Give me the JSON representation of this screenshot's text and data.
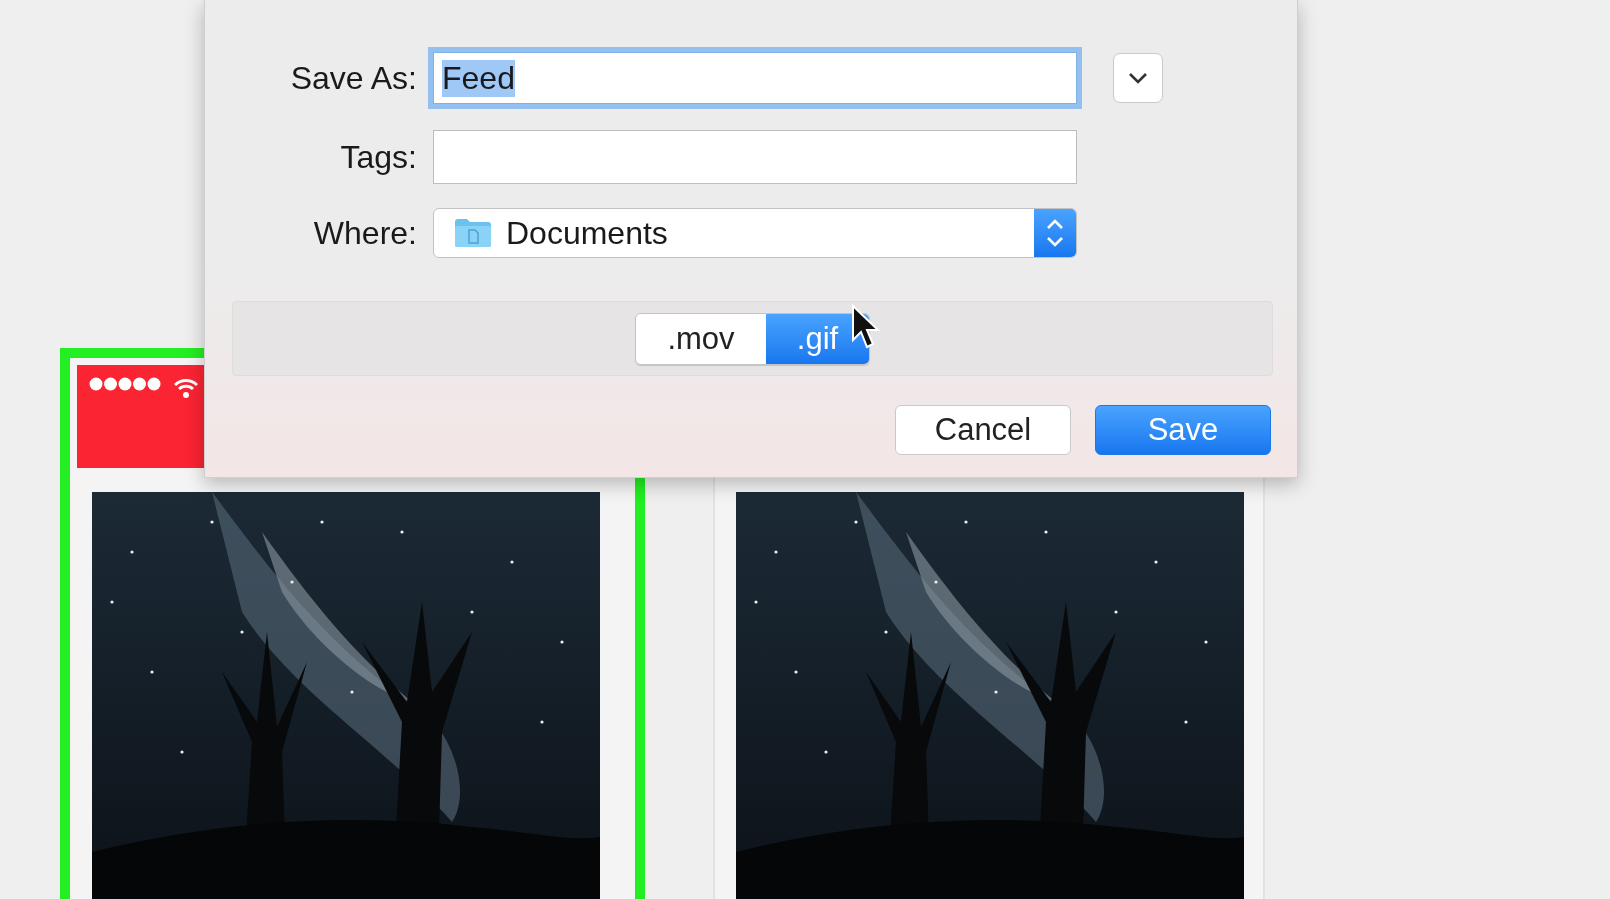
{
  "previews": [
    {
      "kind": "picture",
      "highlighted": true
    },
    {
      "kind": "picture",
      "highlighted": false
    }
  ],
  "dialog": {
    "fields": [
      {
        "kind": "text",
        "label": "Save As:",
        "value": "Feed",
        "focused": true,
        "text_selected": true,
        "menu_button": true
      },
      {
        "kind": "text",
        "label": "Tags:",
        "focused": false,
        "text_selected": false,
        "menu_button": false
      },
      {
        "kind": "popup",
        "label": "Where:",
        "value": "Documents"
      }
    ],
    "format_options": [
      {
        "label": ".mov",
        "selected": false
      },
      {
        "label": ".gif",
        "selected": true
      }
    ],
    "buttons": [
      {
        "label": "Cancel",
        "default": false
      },
      {
        "label": "Save",
        "default": true
      }
    ]
  }
}
